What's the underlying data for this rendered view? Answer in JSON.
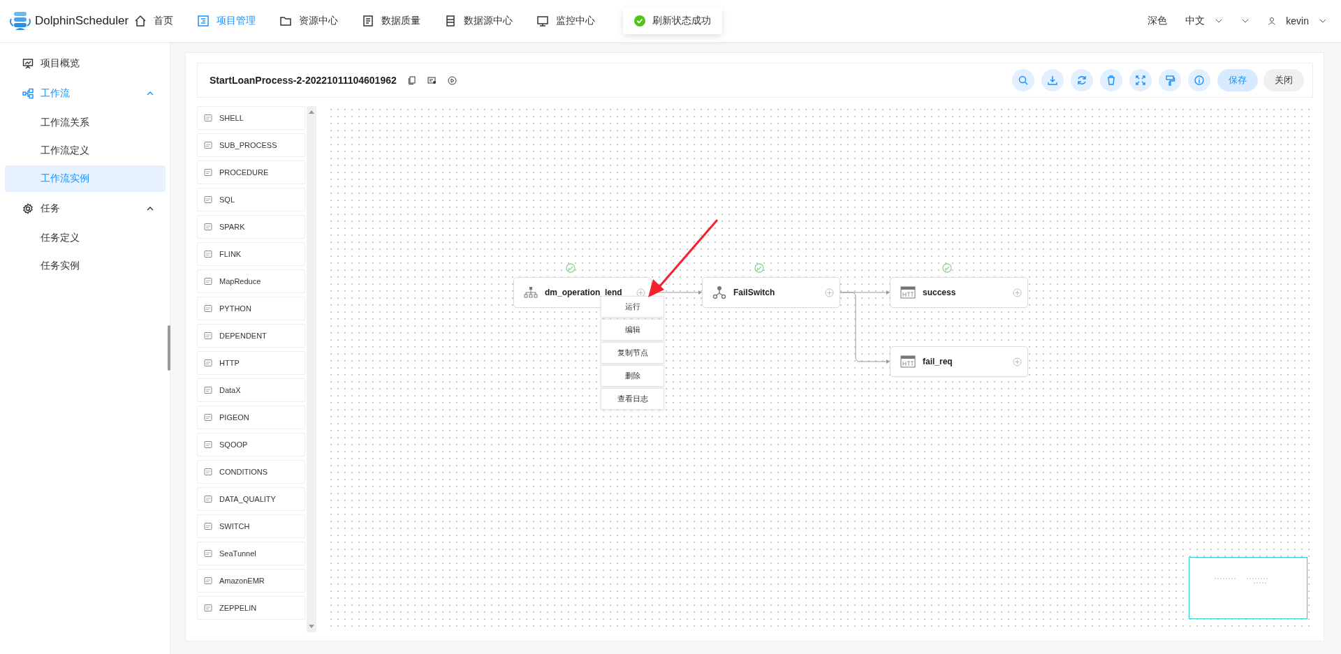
{
  "app": {
    "name": "DolphinScheduler"
  },
  "nav": [
    {
      "label": "首页",
      "selected": false
    },
    {
      "label": "项目管理",
      "selected": true
    },
    {
      "label": "资源中心",
      "selected": false
    },
    {
      "label": "数据质量",
      "selected": false
    },
    {
      "label": "数据源中心",
      "selected": false
    },
    {
      "label": "监控中心",
      "selected": false
    }
  ],
  "toast": {
    "message": "刷新状态成功"
  },
  "header_right": {
    "theme": "深色",
    "language": "中文",
    "user": "kevin"
  },
  "sidebar": {
    "items": [
      {
        "label": "项目概览",
        "selected": false
      },
      {
        "label": "工作流",
        "selected": false,
        "active": true,
        "expanded": true,
        "children": [
          {
            "label": "工作流关系",
            "selected": false
          },
          {
            "label": "工作流定义",
            "selected": false
          },
          {
            "label": "工作流实例",
            "selected": true
          }
        ]
      },
      {
        "label": "任务",
        "selected": false,
        "active": false,
        "expanded": true,
        "children": [
          {
            "label": "任务定义",
            "selected": false
          },
          {
            "label": "任务实例",
            "selected": false
          }
        ]
      }
    ]
  },
  "toolbar": {
    "title": "StartLoanProcess-2-20221011104601962",
    "save": "保存",
    "close": "关闭"
  },
  "task_types": [
    "SHELL",
    "SUB_PROCESS",
    "PROCEDURE",
    "SQL",
    "SPARK",
    "FLINK",
    "MapReduce",
    "PYTHON",
    "DEPENDENT",
    "HTTP",
    "DataX",
    "PIGEON",
    "SQOOP",
    "CONDITIONS",
    "DATA_QUALITY",
    "SWITCH",
    "SeaTunnel",
    "AmazonEMR",
    "ZEPPELIN"
  ],
  "nodes": [
    {
      "name": "dm_operation_lend",
      "kind": "subprocess",
      "succeeded": true
    },
    {
      "name": "FailSwitch",
      "kind": "switch",
      "succeeded": true
    },
    {
      "name": "success",
      "kind": "http",
      "succeeded": true
    },
    {
      "name": "fail_req",
      "kind": "http",
      "succeeded": false
    }
  ],
  "context_menu": [
    "运行",
    "编辑",
    "复制节点",
    "删除",
    "查看日志"
  ]
}
